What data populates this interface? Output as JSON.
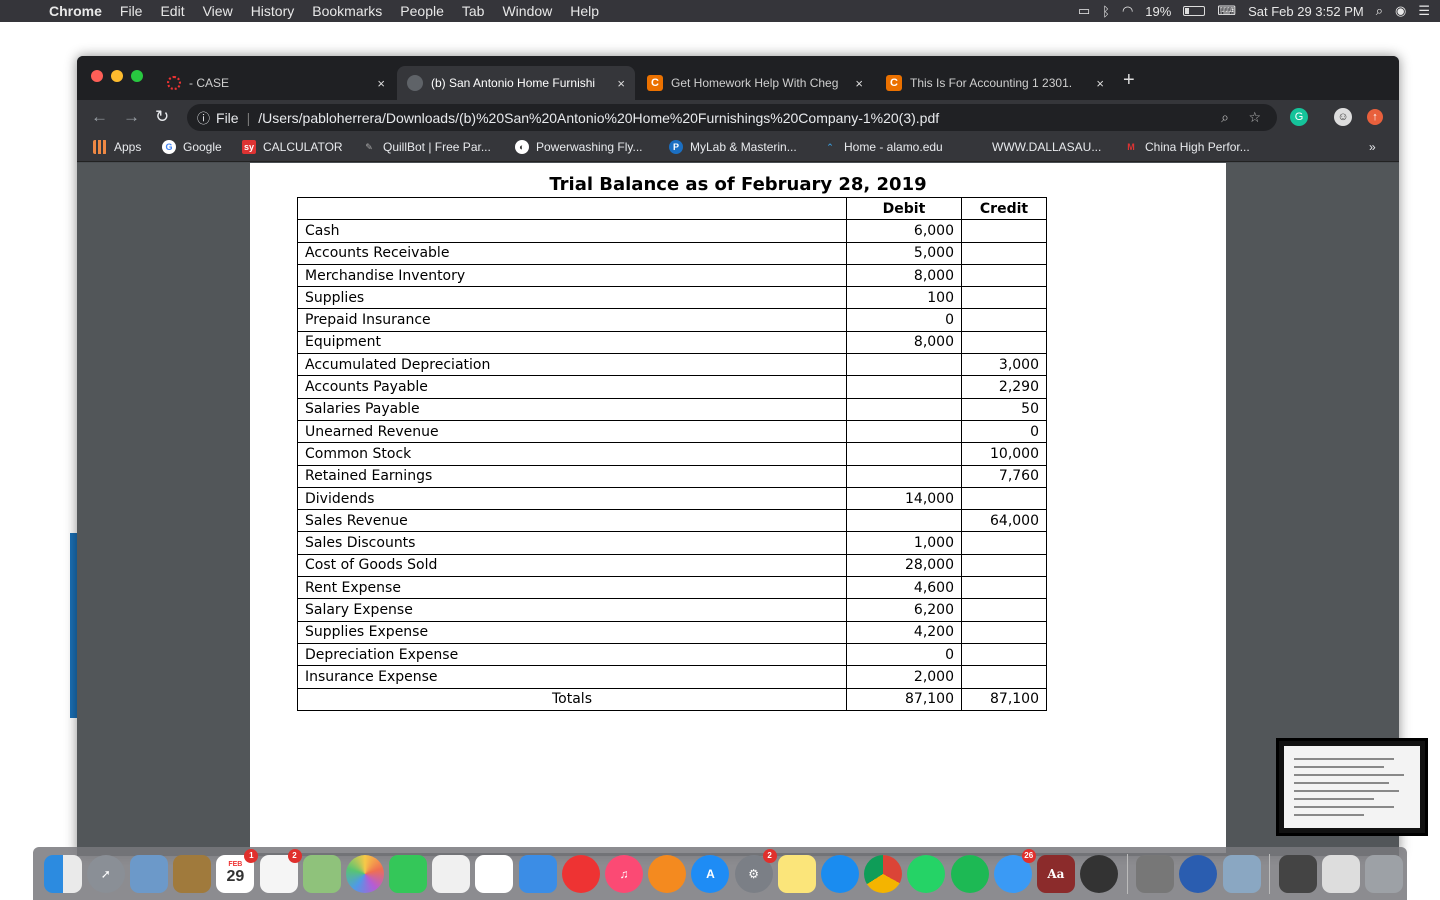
{
  "menubar": {
    "app_name": "Chrome",
    "items": [
      "File",
      "Edit",
      "View",
      "History",
      "Bookmarks",
      "People",
      "Tab",
      "Window",
      "Help"
    ],
    "battery": "19%",
    "clock": "Sat Feb 29  3:52 PM"
  },
  "tabs": [
    {
      "title": "- CASE",
      "close": "×"
    },
    {
      "title": "(b) San Antonio Home Furnishi",
      "close": "×"
    },
    {
      "title": "Get Homework Help With Cheg",
      "close": "×"
    },
    {
      "title": "This Is For Accounting 1 2301.",
      "close": "×"
    }
  ],
  "new_tab": "+",
  "address": {
    "scheme": "File",
    "url": "/Users/pabloherrera/Downloads/(b)%20San%20Antonio%20Home%20Furnishings%20Company-1%20(3).pdf"
  },
  "bookmarks": [
    "Apps",
    "Google",
    "CALCULATOR",
    "QuillBot | Free Par...",
    "Powerwashing Fly...",
    "MyLab & Masterin...",
    "Home - alamo.edu",
    "WWW.DALLASAU...",
    "China High Perfor..."
  ],
  "bookmarks_more": "»",
  "trial_balance": {
    "title": "Trial Balance as of February 28, 2019",
    "headers": {
      "account": "",
      "debit": "Debit",
      "credit": "Credit"
    },
    "rows": [
      {
        "account": "Cash",
        "debit": "6,000",
        "credit": ""
      },
      {
        "account": "Accounts Receivable",
        "debit": "5,000",
        "credit": ""
      },
      {
        "account": "Merchandise Inventory",
        "debit": "8,000",
        "credit": ""
      },
      {
        "account": "Supplies",
        "debit": "100",
        "credit": ""
      },
      {
        "account": "Prepaid Insurance",
        "debit": "0",
        "credit": ""
      },
      {
        "account": "Equipment",
        "debit": "8,000",
        "credit": ""
      },
      {
        "account": "Accumulated Depreciation",
        "debit": "",
        "credit": "3,000"
      },
      {
        "account": "Accounts Payable",
        "debit": "",
        "credit": "2,290"
      },
      {
        "account": "Salaries Payable",
        "debit": "",
        "credit": "50"
      },
      {
        "account": "Unearned Revenue",
        "debit": "",
        "credit": "0"
      },
      {
        "account": "Common Stock",
        "debit": "",
        "credit": "10,000"
      },
      {
        "account": "Retained Earnings",
        "debit": "",
        "credit": "7,760"
      },
      {
        "account": "Dividends",
        "debit": "14,000",
        "credit": ""
      },
      {
        "account": "Sales Revenue",
        "debit": "",
        "credit": "64,000"
      },
      {
        "account": "Sales Discounts",
        "debit": "1,000",
        "credit": ""
      },
      {
        "account": "Cost of Goods Sold",
        "debit": "28,000",
        "credit": ""
      },
      {
        "account": "Rent Expense",
        "debit": "4,600",
        "credit": ""
      },
      {
        "account": "Salary Expense",
        "debit": "6,200",
        "credit": ""
      },
      {
        "account": "Supplies Expense",
        "debit": "4,200",
        "credit": ""
      },
      {
        "account": "Depreciation Expense",
        "debit": "0",
        "credit": ""
      },
      {
        "account": "Insurance Expense",
        "debit": "2,000",
        "credit": ""
      }
    ],
    "totals": {
      "label": "Totals",
      "debit": "87,100",
      "credit": "87,100"
    }
  },
  "dock": {
    "calendar_month": "FEB",
    "calendar_day": "29",
    "dictionary_label": "Aa",
    "badges": {
      "calendar": "1",
      "reminders": "2",
      "system_prefs": "2",
      "messages": "26"
    }
  }
}
